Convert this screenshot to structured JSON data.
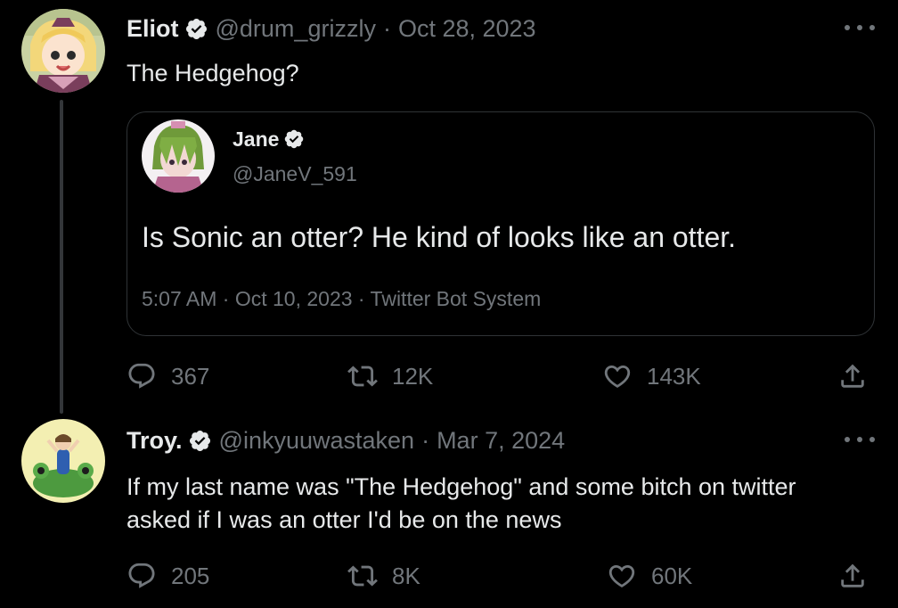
{
  "colors": {
    "background": "#000000",
    "text_primary": "#e7e9ea",
    "text_secondary": "#71767b",
    "verified_badge": "#e7e9ea",
    "border": "#2f3336"
  },
  "tweet1": {
    "display_name": "Eliot",
    "handle": "@drum_grizzly",
    "separator": "·",
    "date": "Oct 28, 2023",
    "text": "The Hedgehog?",
    "avatar_icon": "anime-character-avatar",
    "quote": {
      "display_name": "Jane",
      "handle": "@JaneV_591",
      "text": "Is Sonic an otter? He kind of looks like an otter.",
      "meta": "5:07 AM · Oct 10, 2023 · Twitter Bot System",
      "avatar_icon": "anime-character-avatar"
    },
    "actions": {
      "replies": "367",
      "retweets": "12K",
      "likes": "143K"
    }
  },
  "tweet2": {
    "display_name": "Troy.",
    "handle": "@inkyuuwastaken",
    "separator": "·",
    "date": "Mar 7, 2024",
    "text_line1": "If my last name was \"The Hedgehog\" and some bitch on twitter",
    "text_line2": "asked if I was an otter I'd be on the news",
    "avatar_icon": "character-on-frog-avatar",
    "actions": {
      "replies": "205",
      "retweets": "8K",
      "likes": "60K"
    }
  },
  "icons": {
    "verified": "verified-badge-icon",
    "more": "more-dots-icon",
    "reply": "reply-icon",
    "retweet": "retweet-icon",
    "like": "heart-icon",
    "share": "share-icon"
  }
}
